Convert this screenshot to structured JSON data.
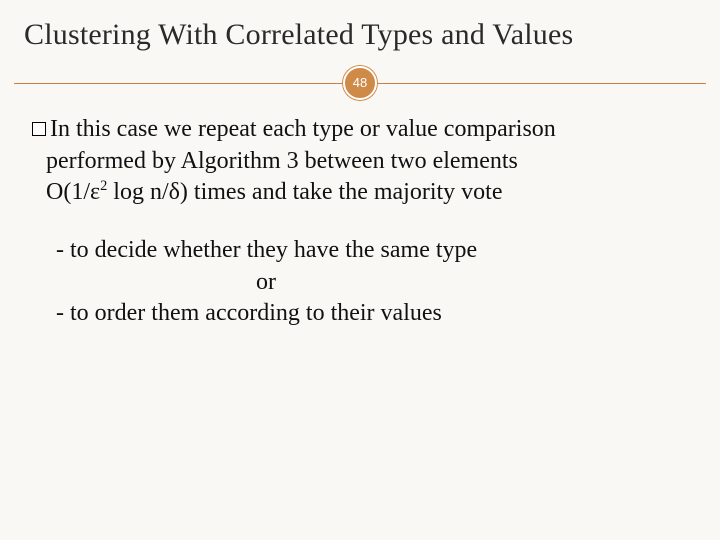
{
  "title": "Clustering With Correlated Types and Values",
  "page_number": "48",
  "bullet": {
    "line1": "In this case we repeat each type or value comparison",
    "line2": "performed by Algorithm 3 between two elements",
    "line3_prefix": "O(1/ε",
    "line3_exp": "2",
    "line3_suffix": " log n/δ) times and take the majority vote"
  },
  "dash1": "- to decide whether they have the same type",
  "or": "or",
  "dash2": "- to order them according to their values"
}
